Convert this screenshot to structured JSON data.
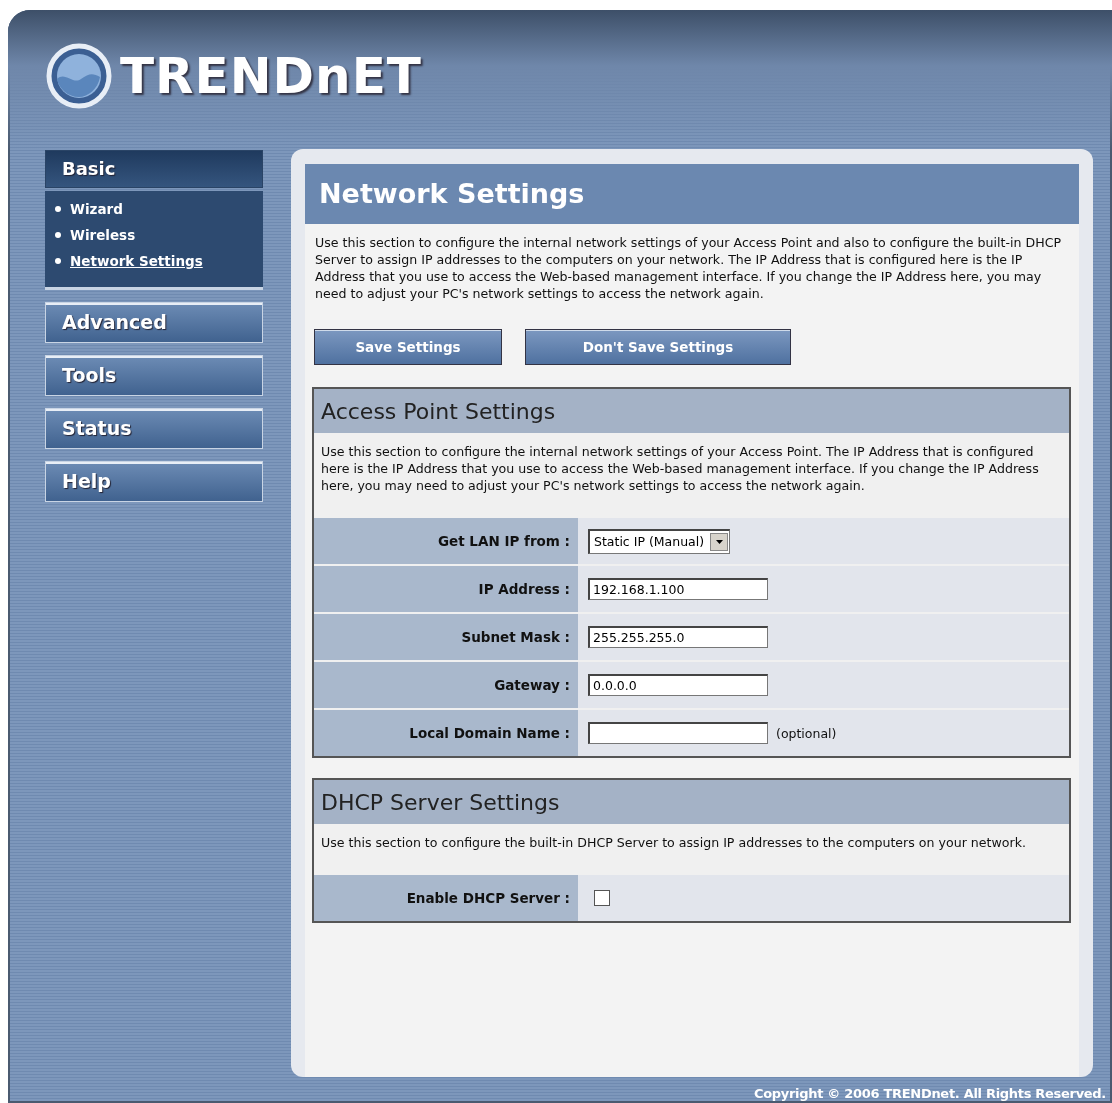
{
  "logo": {
    "text": "TRENDnET"
  },
  "sidebar": {
    "groups": [
      {
        "label": "Basic",
        "expanded": true,
        "children": [
          {
            "label": "Wizard",
            "selected": false
          },
          {
            "label": "Wireless",
            "selected": false
          },
          {
            "label": "Network Settings",
            "selected": true
          }
        ]
      },
      {
        "label": "Advanced",
        "expanded": false
      },
      {
        "label": "Tools",
        "expanded": false
      },
      {
        "label": "Status",
        "expanded": false
      },
      {
        "label": "Help",
        "expanded": false
      }
    ]
  },
  "page": {
    "title": "Network Settings",
    "description": "Use this section to configure the internal network settings of your Access Point and also to configure the built-in DHCP Server to assign IP addresses to the computers on your network. The IP Address that is configured here is the IP Address that you use to access the Web-based management interface. If you change the IP Address here, you may need to adjust your PC's network settings to access the network again.",
    "buttons": [
      "Save Settings",
      "Don't Save Settings"
    ],
    "sections": [
      {
        "title": "Access Point Settings",
        "description": "Use this section to configure the internal network settings of your Access Point. The IP Address that is configured here is the IP Address that you use to access the Web-based management interface. If you change the IP Address here, you may need to adjust your PC's network settings to access the network again.",
        "rows": [
          {
            "kind": "select",
            "label": "Get LAN IP from :",
            "value": "Static IP (Manual)"
          },
          {
            "kind": "text",
            "label": "IP Address :",
            "value": "192.168.1.100"
          },
          {
            "kind": "text",
            "label": "Subnet Mask :",
            "value": "255.255.255.0"
          },
          {
            "kind": "text",
            "label": "Gateway :",
            "value": "0.0.0.0"
          },
          {
            "kind": "text",
            "label": "Local Domain Name :",
            "note": "(optional)"
          }
        ]
      },
      {
        "title": "DHCP Server Settings",
        "description": "Use this section to configure the built-in DHCP Server to assign IP addresses to the computers on your network.",
        "rows": [
          {
            "kind": "checkbox",
            "label": "Enable DHCP Server :",
            "checked": false
          }
        ]
      }
    ]
  },
  "footer": {
    "copyright": "Copyright © 2006 TRENDnet. All Rights Reserved."
  }
}
